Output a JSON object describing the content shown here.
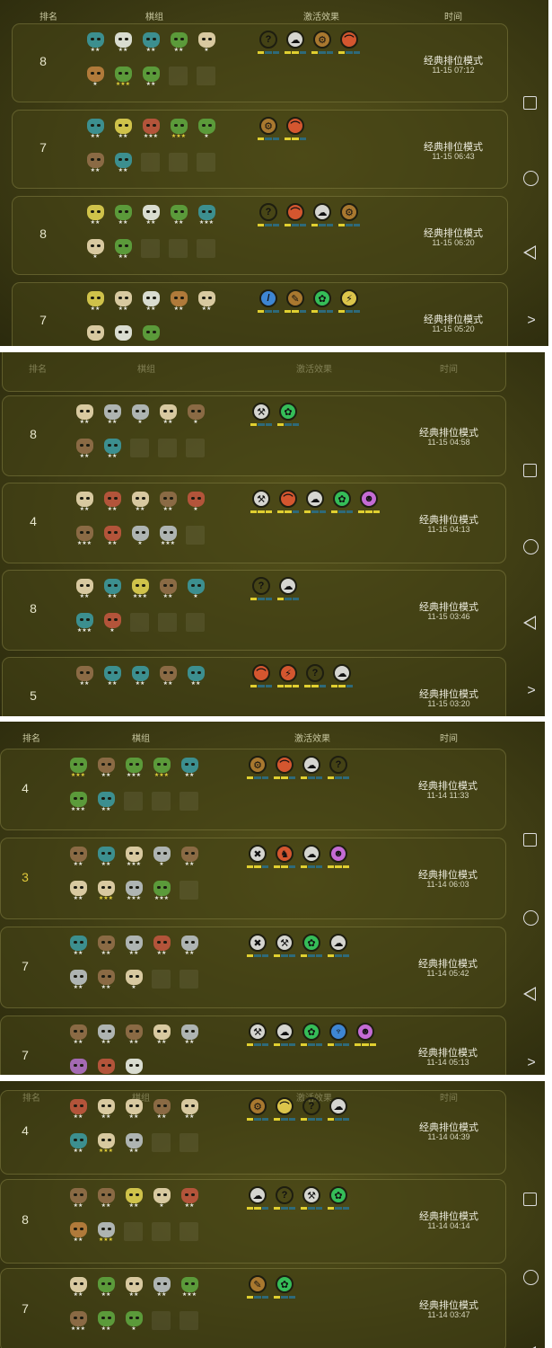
{
  "header": {
    "rank": "排名",
    "lineup": "棋组",
    "synergy": "激活效果",
    "time": "时间"
  },
  "nav": {
    "square": "recent-apps-icon",
    "circle": "home-icon",
    "back": "back-icon",
    "next_label": ">"
  },
  "screens": [
    {
      "matches": [
        {
          "rank": "8",
          "mode": "经典排位模式",
          "time": "11-15 07:12",
          "pieces": [
            [
              "teal",
              "★★"
            ],
            [
              "white",
              "★★"
            ],
            [
              "teal",
              "★★"
            ],
            [
              "green",
              "★★"
            ],
            [
              "cream",
              "★"
            ],
            [
              "bronze",
              "★"
            ],
            [
              "green",
              "★★★"
            ],
            [
              "green",
              "★★"
            ]
          ],
          "synergies": [
            [
              "teal",
              "?",
              [
                1,
                0,
                0
              ]
            ],
            [
              "silver",
              "☁",
              [
                1,
                1,
                0
              ]
            ],
            [
              "bronze",
              "⚙",
              [
                1,
                0,
                0
              ]
            ],
            [
              "red",
              "⌒",
              [
                1,
                0,
                0
              ]
            ]
          ]
        },
        {
          "rank": "7",
          "mode": "经典排位模式",
          "time": "11-15 06:43",
          "pieces": [
            [
              "teal",
              "★★"
            ],
            [
              "gold",
              "★★"
            ],
            [
              "red",
              "★★★"
            ],
            [
              "green",
              "★★★"
            ],
            [
              "green",
              "★"
            ],
            [
              "brown",
              "★★"
            ],
            [
              "teal",
              "★★"
            ]
          ],
          "synergies": [
            [
              "bronze",
              "⚙",
              [
                1,
                0,
                0
              ]
            ],
            [
              "red",
              "⌒",
              [
                1,
                1,
                0
              ]
            ]
          ]
        },
        {
          "rank": "8",
          "mode": "经典排位模式",
          "time": "11-15 06:20",
          "pieces": [
            [
              "gold",
              "★★"
            ],
            [
              "green",
              "★★"
            ],
            [
              "white",
              "★★"
            ],
            [
              "green",
              "★★"
            ],
            [
              "teal",
              "★★★"
            ],
            [
              "cream",
              "★"
            ],
            [
              "green",
              "★★"
            ]
          ],
          "synergies": [
            [
              "teal",
              "?",
              [
                1,
                0,
                0
              ]
            ],
            [
              "red",
              "⌒",
              [
                1,
                0,
                0
              ]
            ],
            [
              "silver",
              "☁",
              [
                1,
                0,
                0
              ]
            ],
            [
              "bronze",
              "⚙",
              [
                1,
                0,
                0
              ]
            ]
          ]
        },
        {
          "rank": "7",
          "mode": "经典排位模式",
          "time": "11-15 05:20",
          "pieces": [
            [
              "gold",
              "★★"
            ],
            [
              "cream",
              "★★"
            ],
            [
              "white",
              "★★"
            ],
            [
              "bronze",
              "★★"
            ],
            [
              "cream",
              "★★"
            ],
            [
              "cream",
              ""
            ],
            [
              "white",
              ""
            ],
            [
              "green",
              ""
            ]
          ],
          "synergies": [
            [
              "blue",
              "/",
              [
                1,
                0,
                0
              ]
            ],
            [
              "bronze",
              "✎",
              [
                1,
                1,
                0
              ]
            ],
            [
              "green",
              "✿",
              [
                1,
                0,
                0
              ]
            ],
            [
              "gold",
              "⚡",
              [
                1,
                0,
                0
              ]
            ]
          ]
        }
      ]
    },
    {
      "matches": [
        {
          "rank": "8",
          "mode": "经典排位模式",
          "time": "11-15 04:58",
          "pieces": [
            [
              "cream",
              "★★"
            ],
            [
              "silver",
              "★★"
            ],
            [
              "silver",
              "★"
            ],
            [
              "cream",
              "★★"
            ],
            [
              "brown",
              "★"
            ],
            [
              "brown",
              "★★"
            ],
            [
              "teal",
              "★★"
            ]
          ],
          "synergies": [
            [
              "silver",
              "⚒",
              [
                1,
                0,
                0
              ]
            ],
            [
              "green",
              "✿",
              [
                1,
                0,
                0
              ]
            ]
          ]
        },
        {
          "rank": "4",
          "mode": "经典排位模式",
          "time": "11-15 04:13",
          "pieces": [
            [
              "cream",
              "★★"
            ],
            [
              "red",
              "★★"
            ],
            [
              "cream",
              "★★"
            ],
            [
              "brown",
              "★★"
            ],
            [
              "red",
              "★"
            ],
            [
              "brown",
              "★★★"
            ],
            [
              "red",
              "★★"
            ],
            [
              "silver",
              "★"
            ],
            [
              "silver",
              "★★★"
            ]
          ],
          "synergies": [
            [
              "silver",
              "⚒",
              [
                1,
                1,
                1
              ]
            ],
            [
              "red",
              "⌒",
              [
                1,
                1,
                0
              ]
            ],
            [
              "silver",
              "☁",
              [
                1,
                0,
                0
              ]
            ],
            [
              "green",
              "✿",
              [
                1,
                0,
                0
              ]
            ],
            [
              "pink",
              "☻",
              [
                1,
                1,
                1
              ]
            ]
          ]
        },
        {
          "rank": "8",
          "mode": "经典排位模式",
          "time": "11-15 03:46",
          "pieces": [
            [
              "cream",
              "★★"
            ],
            [
              "teal",
              "★★"
            ],
            [
              "gold",
              "★★★"
            ],
            [
              "brown",
              "★★"
            ],
            [
              "teal",
              "★"
            ],
            [
              "teal",
              "★★★"
            ],
            [
              "red",
              "★"
            ]
          ],
          "synergies": [
            [
              "teal",
              "?",
              [
                1,
                0,
                0
              ]
            ],
            [
              "silver",
              "☁",
              [
                1,
                0,
                0
              ]
            ]
          ]
        },
        {
          "rank": "5",
          "mode": "经典排位模式",
          "time": "11-15 03:20",
          "pieces": [
            [
              "brown",
              "★★"
            ],
            [
              "teal",
              "★★"
            ],
            [
              "teal",
              "★★"
            ],
            [
              "brown",
              "★★"
            ],
            [
              "teal",
              "★★"
            ]
          ],
          "synergies": [
            [
              "red",
              "⌒",
              [
                1,
                0,
                0
              ]
            ],
            [
              "red",
              "⚡",
              [
                1,
                1,
                1
              ]
            ],
            [
              "teal",
              "?",
              [
                1,
                1,
                0
              ]
            ],
            [
              "silver",
              "☁",
              [
                1,
                1,
                0
              ]
            ]
          ]
        }
      ]
    },
    {
      "matches": [
        {
          "rank": "4",
          "mode": "经典排位模式",
          "time": "11-14 11:33",
          "pieces": [
            [
              "green",
              "★★★"
            ],
            [
              "brown",
              "★★"
            ],
            [
              "green",
              "★★★"
            ],
            [
              "green",
              "★★★"
            ],
            [
              "teal",
              "★★"
            ],
            [
              "green",
              "★★★"
            ],
            [
              "teal",
              "★★"
            ]
          ],
          "synergies": [
            [
              "bronze",
              "⚙",
              [
                1,
                0,
                0
              ]
            ],
            [
              "red",
              "⌒",
              [
                1,
                1,
                0
              ]
            ],
            [
              "silver",
              "☁",
              [
                1,
                0,
                0
              ]
            ],
            [
              "teal",
              "?",
              [
                1,
                0,
                0
              ]
            ]
          ]
        },
        {
          "rank": "3",
          "gold": true,
          "mode": "经典排位模式",
          "time": "11-14 06:03",
          "pieces": [
            [
              "brown",
              "★★"
            ],
            [
              "teal",
              "★★"
            ],
            [
              "cream",
              "★★★"
            ],
            [
              "silver",
              "★"
            ],
            [
              "brown",
              "★★"
            ],
            [
              "cream",
              "★★"
            ],
            [
              "cream",
              "★★★"
            ],
            [
              "silver",
              "★★★"
            ],
            [
              "green",
              "★★★"
            ]
          ],
          "synergies": [
            [
              "silver",
              "✖",
              [
                1,
                1,
                0
              ]
            ],
            [
              "red",
              "♞",
              [
                1,
                1,
                0
              ]
            ],
            [
              "silver",
              "☁",
              [
                1,
                0,
                0
              ]
            ],
            [
              "pink",
              "☻",
              [
                1,
                1,
                1
              ]
            ]
          ]
        },
        {
          "rank": "7",
          "mode": "经典排位模式",
          "time": "11-14 05:42",
          "pieces": [
            [
              "teal",
              "★★"
            ],
            [
              "brown",
              "★★"
            ],
            [
              "silver",
              "★★"
            ],
            [
              "red",
              "★★"
            ],
            [
              "silver",
              "★★"
            ],
            [
              "silver",
              "★★"
            ],
            [
              "brown",
              "★★"
            ],
            [
              "cream",
              "★"
            ]
          ],
          "synergies": [
            [
              "silver",
              "✖",
              [
                1,
                0,
                0
              ]
            ],
            [
              "silver",
              "⚒",
              [
                1,
                0,
                0
              ]
            ],
            [
              "green",
              "✿",
              [
                1,
                0,
                0
              ]
            ],
            [
              "silver",
              "☁",
              [
                1,
                0,
                0
              ]
            ]
          ]
        },
        {
          "rank": "7",
          "mode": "经典排位模式",
          "time": "11-14 05:13",
          "pieces": [
            [
              "brown",
              "★★"
            ],
            [
              "silver",
              "★★"
            ],
            [
              "brown",
              "★★"
            ],
            [
              "cream",
              "★★"
            ],
            [
              "silver",
              "★★"
            ],
            [
              "pink",
              ""
            ],
            [
              "red",
              ""
            ],
            [
              "white",
              ""
            ]
          ],
          "synergies": [
            [
              "silver",
              "⚒",
              [
                1,
                0,
                0
              ]
            ],
            [
              "silver",
              "☁",
              [
                1,
                0,
                0
              ]
            ],
            [
              "green",
              "✿",
              [
                1,
                0,
                0
              ]
            ],
            [
              "blue",
              "♆",
              [
                1,
                0,
                0
              ]
            ],
            [
              "pink",
              "☻",
              [
                1,
                1,
                1
              ]
            ]
          ]
        }
      ]
    },
    {
      "matches": [
        {
          "rank": "4",
          "mode": "经典排位模式",
          "time": "11-14 04:39",
          "pieces": [
            [
              "red",
              "★★"
            ],
            [
              "cream",
              "★★"
            ],
            [
              "cream",
              "★★"
            ],
            [
              "brown",
              "★★"
            ],
            [
              "cream",
              "★★"
            ],
            [
              "teal",
              "★★"
            ],
            [
              "cream",
              "★★★"
            ],
            [
              "silver",
              "★★"
            ]
          ],
          "synergies": [
            [
              "bronze",
              "⚙",
              [
                1,
                0,
                0
              ]
            ],
            [
              "gold",
              "⌒",
              [
                1,
                0,
                0
              ]
            ],
            [
              "teal",
              "?",
              [
                1,
                0,
                0
              ]
            ],
            [
              "silver",
              "☁",
              [
                1,
                0,
                0
              ]
            ]
          ]
        },
        {
          "rank": "8",
          "mode": "经典排位模式",
          "time": "11-14 04:14",
          "pieces": [
            [
              "brown",
              "★★"
            ],
            [
              "brown",
              "★★"
            ],
            [
              "gold",
              "★★"
            ],
            [
              "cream",
              "★"
            ],
            [
              "red",
              "★★"
            ],
            [
              "bronze",
              "★★"
            ],
            [
              "silver",
              "★★★"
            ]
          ],
          "synergies": [
            [
              "silver",
              "☁",
              [
                1,
                1,
                0
              ]
            ],
            [
              "teal",
              "?",
              [
                1,
                0,
                0
              ]
            ],
            [
              "silver",
              "⚒",
              [
                1,
                0,
                0
              ]
            ],
            [
              "green",
              "✿",
              [
                1,
                0,
                0
              ]
            ]
          ]
        },
        {
          "rank": "7",
          "mode": "经典排位模式",
          "time": "11-14 03:47",
          "pieces": [
            [
              "cream",
              "★★"
            ],
            [
              "green",
              "★★"
            ],
            [
              "cream",
              "★★"
            ],
            [
              "silver",
              "★★"
            ],
            [
              "green",
              "★★★"
            ],
            [
              "brown",
              "★★★"
            ],
            [
              "green",
              "★★"
            ],
            [
              "green",
              "★"
            ]
          ],
          "synergies": [
            [
              "bronze",
              "✎",
              [
                1,
                0,
                0
              ]
            ],
            [
              "green",
              "✿",
              [
                1,
                0,
                0
              ]
            ]
          ]
        }
      ]
    }
  ],
  "palette": {
    "teal": "#3c8f8f",
    "white": "#d9dcd0",
    "green": "#5b9a3a",
    "cream": "#d8c9a0",
    "bronze": "#b07a3a",
    "gold": "#cfc24a",
    "red": "#b3543a",
    "brown": "#8a6a44",
    "silver": "#aeb4b2",
    "pink": "#a46ab3"
  }
}
